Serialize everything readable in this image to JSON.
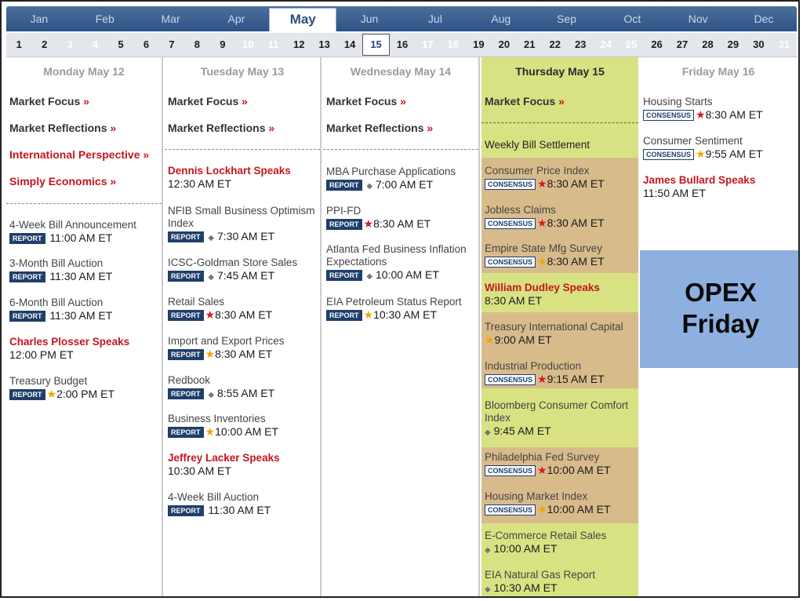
{
  "months": [
    "Jan",
    "Feb",
    "Mar",
    "Apr",
    "May",
    "Jun",
    "Jul",
    "Aug",
    "Sep",
    "Oct",
    "Nov",
    "Dec"
  ],
  "active_month": "May",
  "days": [
    "1",
    "2",
    "3",
    "4",
    "5",
    "6",
    "7",
    "8",
    "9",
    "10",
    "11",
    "12",
    "13",
    "14",
    "15",
    "16",
    "17",
    "18",
    "19",
    "20",
    "21",
    "22",
    "23",
    "24",
    "25",
    "26",
    "27",
    "28",
    "29",
    "30",
    "31"
  ],
  "active_day": "15",
  "columns": {
    "mon": {
      "header": "Monday May 12",
      "links": [
        "Market Focus",
        "Market Reflections",
        "International Perspective",
        "Simply Economics"
      ],
      "arrow": "»",
      "events": [
        {
          "name": "4-Week Bill Announcement",
          "badge": "REPORT",
          "time": "11:00 AM ET"
        },
        {
          "name": "3-Month Bill Auction",
          "badge": "REPORT",
          "time": "11:30 AM ET"
        },
        {
          "name": "6-Month Bill Auction",
          "badge": "REPORT",
          "time": "11:30 AM ET"
        },
        {
          "name": "Charles Plosser Speaks",
          "time": "12:00 PM ET"
        },
        {
          "name": "Treasury Budget",
          "badge": "REPORT",
          "time": "2:00 PM ET"
        }
      ]
    },
    "tue": {
      "header": "Tuesday May 13",
      "links": [
        "Market Focus",
        "Market Reflections"
      ],
      "events": [
        {
          "name": "Dennis Lockhart Speaks",
          "time": "12:30 AM ET"
        },
        {
          "name": "NFIB Small Business Optimism Index",
          "badge": "REPORT",
          "time": "7:30 AM ET"
        },
        {
          "name": "ICSC-Goldman Store Sales",
          "badge": "REPORT",
          "time": "7:45 AM ET"
        },
        {
          "name": "Retail Sales",
          "badge": "REPORT",
          "time": "8:30 AM ET"
        },
        {
          "name": "Import and Export Prices",
          "badge": "REPORT",
          "time": "8:30 AM ET"
        },
        {
          "name": "Redbook",
          "badge": "REPORT",
          "time": "8:55 AM ET"
        },
        {
          "name": "Business Inventories",
          "badge": "REPORT",
          "time": "10:00 AM ET"
        },
        {
          "name": "Jeffrey Lacker Speaks",
          "time": "10:30 AM ET"
        },
        {
          "name": "4-Week Bill Auction",
          "badge": "REPORT",
          "time": "11:30 AM ET"
        }
      ]
    },
    "wed": {
      "header": "Wednesday May 14",
      "links": [
        "Market Focus",
        "Market Reflections"
      ],
      "events": [
        {
          "name": "MBA Purchase Applications",
          "badge": "REPORT",
          "time": "7:00 AM ET"
        },
        {
          "name": "PPI-FD",
          "badge": "REPORT",
          "time": "8:30 AM ET"
        },
        {
          "name": "Atlanta Fed Business Inflation Expectations",
          "badge": "REPORT",
          "time": "10:00 AM ET"
        },
        {
          "name": "EIA Petroleum Status Report",
          "badge": "REPORT",
          "time": "10:30 AM ET"
        }
      ]
    },
    "thu": {
      "header": "Thursday May 15",
      "links": [
        "Market Focus"
      ],
      "events": [
        {
          "name": "Weekly Bill Settlement"
        },
        {
          "name": "Consumer Price Index",
          "badge": "CONSENSUS",
          "time": "8:30 AM ET"
        },
        {
          "name": "Jobless Claims",
          "badge": "CONSENSUS",
          "time": "8:30 AM ET"
        },
        {
          "name": "Empire State Mfg Survey",
          "badge": "CONSENSUS",
          "time": "8:30 AM ET"
        },
        {
          "name": "William Dudley Speaks",
          "time": "8:30 AM ET"
        },
        {
          "name": "Treasury International Capital",
          "time": "9:00 AM ET"
        },
        {
          "name": "Industrial Production",
          "badge": "CONSENSUS",
          "time": "9:15 AM ET"
        },
        {
          "name": "Bloomberg Consumer Comfort Index",
          "time": "9:45 AM ET"
        },
        {
          "name": "Philadelphia Fed Survey",
          "badge": "CONSENSUS",
          "time": "10:00 AM ET"
        },
        {
          "name": "Housing Market Index",
          "badge": "CONSENSUS",
          "time": "10:00 AM ET"
        },
        {
          "name": "E-Commerce Retail Sales",
          "time": "10:00 AM ET"
        },
        {
          "name": "EIA Natural Gas Report",
          "time": "10:30 AM ET"
        }
      ]
    },
    "fri": {
      "header": "Friday May 16",
      "events": [
        {
          "name": "Housing Starts",
          "badge": "CONSENSUS",
          "time": "8:30 AM ET"
        },
        {
          "name": "Consumer Sentiment",
          "badge": "CONSENSUS",
          "time": "9:55 AM ET"
        },
        {
          "name": "James Bullard Speaks",
          "time": "11:50 AM ET"
        }
      ]
    }
  },
  "opex": {
    "line1": "OPEX",
    "line2": "Friday"
  },
  "colors": {
    "accent_red": "#c4161c",
    "thursday_bg": "#d9e283",
    "highlight_tan": "#d8bb8b",
    "opex_bg": "#8db0e0",
    "report_badge": "#1f3f6b"
  }
}
